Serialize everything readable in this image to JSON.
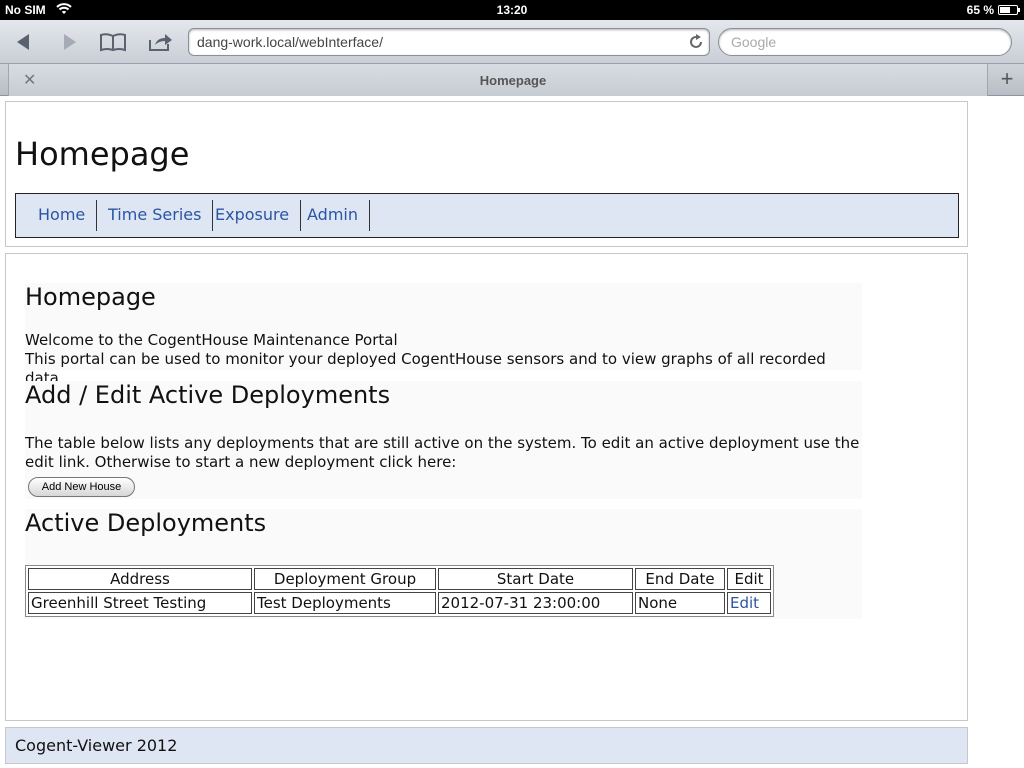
{
  "status_bar": {
    "carrier": "No SIM",
    "time": "13:20",
    "battery": "65 %",
    "battery_level": 0.65
  },
  "browser": {
    "url": "dang-work.local/webInterface/",
    "search_placeholder": "Google",
    "tab_title": "Homepage",
    "icons": [
      "back-icon",
      "forward-icon",
      "bookmarks-icon",
      "share-icon",
      "reload-icon",
      "close-icon",
      "plus-icon"
    ]
  },
  "page": {
    "title": "Homepage",
    "nav": [
      "Home",
      "Time Series",
      "Exposure",
      "Admin"
    ],
    "intro": {
      "heading": "Homepage",
      "line1": "Welcome to the CogentHouse Maintenance Portal",
      "line2": "This portal can be used to monitor your deployed CogentHouse sensors and to view graphs of all recorded data."
    },
    "add_edit": {
      "heading": "Add / Edit Active Deployments",
      "text": "The table below lists any deployments that are still active on the system. To edit an active deployment use the edit link. Otherwise to start a new deployment click here:",
      "button": "Add New House"
    },
    "active": {
      "heading": "Active Deployments",
      "columns": [
        "Address",
        "Deployment Group",
        "Start Date",
        "End Date",
        "Edit"
      ],
      "rows": [
        [
          "Greenhill Street Testing",
          "Test Deployments",
          "2012-07-31 23:00:00",
          "None",
          "Edit"
        ]
      ]
    },
    "footer": "Cogent-Viewer 2012"
  },
  "colors": {
    "nav_bg": "#dfe6f3",
    "link": "#2a55a4"
  }
}
